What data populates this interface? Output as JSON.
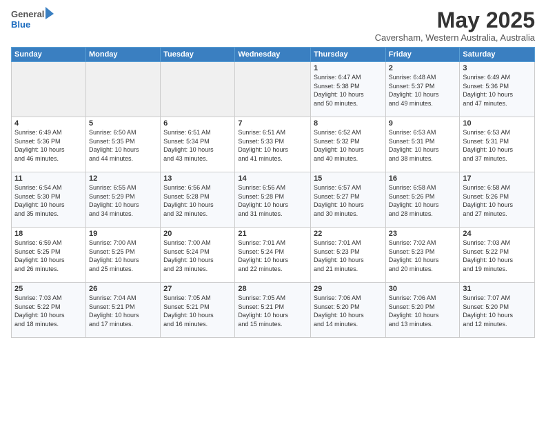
{
  "header": {
    "logo_general": "General",
    "logo_blue": "Blue",
    "month_title": "May 2025",
    "subtitle": "Caversham, Western Australia, Australia"
  },
  "weekdays": [
    "Sunday",
    "Monday",
    "Tuesday",
    "Wednesday",
    "Thursday",
    "Friday",
    "Saturday"
  ],
  "weeks": [
    [
      {
        "num": "",
        "detail": ""
      },
      {
        "num": "",
        "detail": ""
      },
      {
        "num": "",
        "detail": ""
      },
      {
        "num": "",
        "detail": ""
      },
      {
        "num": "1",
        "detail": "Sunrise: 6:47 AM\nSunset: 5:38 PM\nDaylight: 10 hours\nand 50 minutes."
      },
      {
        "num": "2",
        "detail": "Sunrise: 6:48 AM\nSunset: 5:37 PM\nDaylight: 10 hours\nand 49 minutes."
      },
      {
        "num": "3",
        "detail": "Sunrise: 6:49 AM\nSunset: 5:36 PM\nDaylight: 10 hours\nand 47 minutes."
      }
    ],
    [
      {
        "num": "4",
        "detail": "Sunrise: 6:49 AM\nSunset: 5:36 PM\nDaylight: 10 hours\nand 46 minutes."
      },
      {
        "num": "5",
        "detail": "Sunrise: 6:50 AM\nSunset: 5:35 PM\nDaylight: 10 hours\nand 44 minutes."
      },
      {
        "num": "6",
        "detail": "Sunrise: 6:51 AM\nSunset: 5:34 PM\nDaylight: 10 hours\nand 43 minutes."
      },
      {
        "num": "7",
        "detail": "Sunrise: 6:51 AM\nSunset: 5:33 PM\nDaylight: 10 hours\nand 41 minutes."
      },
      {
        "num": "8",
        "detail": "Sunrise: 6:52 AM\nSunset: 5:32 PM\nDaylight: 10 hours\nand 40 minutes."
      },
      {
        "num": "9",
        "detail": "Sunrise: 6:53 AM\nSunset: 5:31 PM\nDaylight: 10 hours\nand 38 minutes."
      },
      {
        "num": "10",
        "detail": "Sunrise: 6:53 AM\nSunset: 5:31 PM\nDaylight: 10 hours\nand 37 minutes."
      }
    ],
    [
      {
        "num": "11",
        "detail": "Sunrise: 6:54 AM\nSunset: 5:30 PM\nDaylight: 10 hours\nand 35 minutes."
      },
      {
        "num": "12",
        "detail": "Sunrise: 6:55 AM\nSunset: 5:29 PM\nDaylight: 10 hours\nand 34 minutes."
      },
      {
        "num": "13",
        "detail": "Sunrise: 6:56 AM\nSunset: 5:28 PM\nDaylight: 10 hours\nand 32 minutes."
      },
      {
        "num": "14",
        "detail": "Sunrise: 6:56 AM\nSunset: 5:28 PM\nDaylight: 10 hours\nand 31 minutes."
      },
      {
        "num": "15",
        "detail": "Sunrise: 6:57 AM\nSunset: 5:27 PM\nDaylight: 10 hours\nand 30 minutes."
      },
      {
        "num": "16",
        "detail": "Sunrise: 6:58 AM\nSunset: 5:26 PM\nDaylight: 10 hours\nand 28 minutes."
      },
      {
        "num": "17",
        "detail": "Sunrise: 6:58 AM\nSunset: 5:26 PM\nDaylight: 10 hours\nand 27 minutes."
      }
    ],
    [
      {
        "num": "18",
        "detail": "Sunrise: 6:59 AM\nSunset: 5:25 PM\nDaylight: 10 hours\nand 26 minutes."
      },
      {
        "num": "19",
        "detail": "Sunrise: 7:00 AM\nSunset: 5:25 PM\nDaylight: 10 hours\nand 25 minutes."
      },
      {
        "num": "20",
        "detail": "Sunrise: 7:00 AM\nSunset: 5:24 PM\nDaylight: 10 hours\nand 23 minutes."
      },
      {
        "num": "21",
        "detail": "Sunrise: 7:01 AM\nSunset: 5:24 PM\nDaylight: 10 hours\nand 22 minutes."
      },
      {
        "num": "22",
        "detail": "Sunrise: 7:01 AM\nSunset: 5:23 PM\nDaylight: 10 hours\nand 21 minutes."
      },
      {
        "num": "23",
        "detail": "Sunrise: 7:02 AM\nSunset: 5:23 PM\nDaylight: 10 hours\nand 20 minutes."
      },
      {
        "num": "24",
        "detail": "Sunrise: 7:03 AM\nSunset: 5:22 PM\nDaylight: 10 hours\nand 19 minutes."
      }
    ],
    [
      {
        "num": "25",
        "detail": "Sunrise: 7:03 AM\nSunset: 5:22 PM\nDaylight: 10 hours\nand 18 minutes."
      },
      {
        "num": "26",
        "detail": "Sunrise: 7:04 AM\nSunset: 5:21 PM\nDaylight: 10 hours\nand 17 minutes."
      },
      {
        "num": "27",
        "detail": "Sunrise: 7:05 AM\nSunset: 5:21 PM\nDaylight: 10 hours\nand 16 minutes."
      },
      {
        "num": "28",
        "detail": "Sunrise: 7:05 AM\nSunset: 5:21 PM\nDaylight: 10 hours\nand 15 minutes."
      },
      {
        "num": "29",
        "detail": "Sunrise: 7:06 AM\nSunset: 5:20 PM\nDaylight: 10 hours\nand 14 minutes."
      },
      {
        "num": "30",
        "detail": "Sunrise: 7:06 AM\nSunset: 5:20 PM\nDaylight: 10 hours\nand 13 minutes."
      },
      {
        "num": "31",
        "detail": "Sunrise: 7:07 AM\nSunset: 5:20 PM\nDaylight: 10 hours\nand 12 minutes."
      }
    ]
  ]
}
